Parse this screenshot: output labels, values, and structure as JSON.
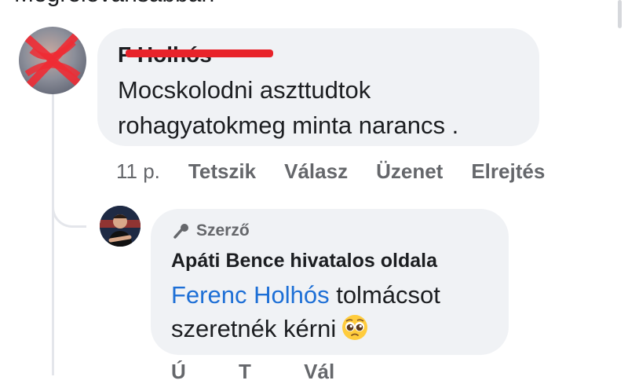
{
  "header": {
    "partial_text": "Megrelevánsabban"
  },
  "comment": {
    "author_visible": "F            Holhós",
    "text_line1": "Mocskolodni aszttudtok",
    "text_line2": "rohagyatokmeg minta narancs .",
    "time": "11 p.",
    "actions": [
      "Tetszik",
      "Válasz",
      "Üzenet",
      "Elrejtés"
    ]
  },
  "reply": {
    "badge": "Szerző",
    "author": "Apáti Bence hivatalos oldala",
    "mention": "Ferenc Holhós",
    "text_after_mention": " tolmácsot",
    "text_line2": "szeretnék kérni",
    "emoji": "pleading-face",
    "actions_partial": [
      "Ú",
      "T",
      "Vál"
    ]
  },
  "colors": {
    "bubble": "#f0f2f5",
    "mention": "#1d6fd6",
    "secondary_text": "#65676b",
    "redaction": "#e8232a"
  }
}
